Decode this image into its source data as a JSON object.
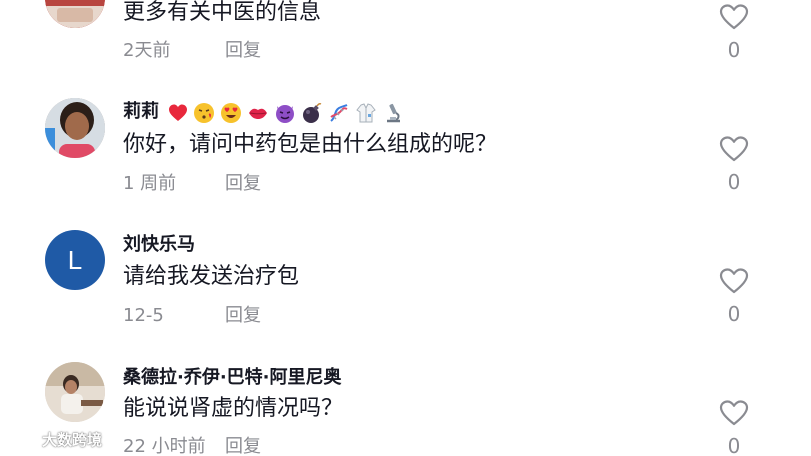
{
  "comments": [
    {
      "username": "",
      "text": "更多有关中医的信息",
      "time": "2天前",
      "reply": "回复",
      "likes": "0",
      "avatar": {
        "type": "photo",
        "color": "#c2403f"
      }
    },
    {
      "username": "莉莉",
      "emojis": [
        "heart-emoji",
        "kiss-face-emoji",
        "heart-eyes-emoji",
        "lips-emoji",
        "devil-emoji",
        "bomb-emoji",
        "dna-emoji",
        "lab-coat-emoji",
        "microscope-emoji"
      ],
      "text": "你好，请问中药包是由什么组成的呢？",
      "time": "1 周前",
      "reply": "回复",
      "likes": "0",
      "avatar": {
        "type": "photo",
        "color": "#6b5446"
      }
    },
    {
      "username": "刘快乐马",
      "text": "请给我发送治疗包",
      "time": "12-5",
      "reply": "回复",
      "likes": "0",
      "avatar": {
        "type": "letter",
        "letter": "L",
        "color": "#1f5aa6"
      }
    },
    {
      "username": "桑德拉·乔伊·巴特·阿里尼奥",
      "text": "能说说肾虚的情况吗？",
      "time": "22 小时前",
      "reply": "回复",
      "likes": "0",
      "avatar": {
        "type": "photo",
        "color": "#d9cfc2"
      }
    }
  ],
  "watermark": {
    "text": "大数跨境"
  },
  "colors": {
    "text": "#161823",
    "meta": "#8a8b91",
    "heart_stroke": "#8a8b91"
  }
}
